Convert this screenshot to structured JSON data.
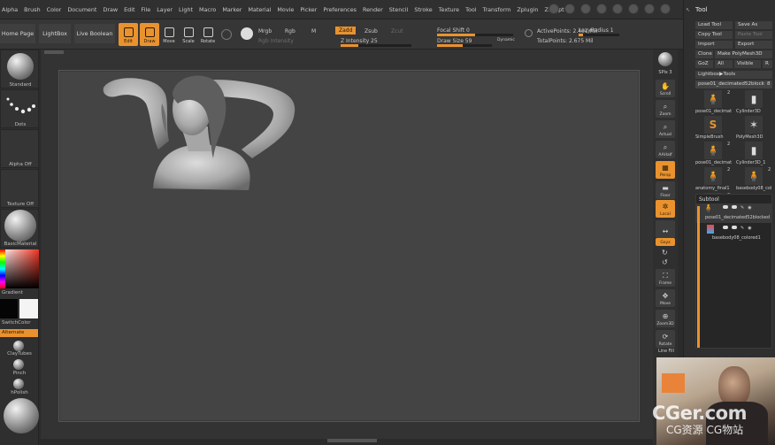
{
  "menu": [
    "Alpha",
    "Brush",
    "Color",
    "Document",
    "Draw",
    "Edit",
    "File",
    "Layer",
    "Light",
    "Macro",
    "Marker",
    "Material",
    "Movie",
    "Picker",
    "Preferences",
    "Render",
    "Stencil",
    "Stroke",
    "Texture",
    "Tool",
    "Transform",
    "Zplugin",
    "Zscript"
  ],
  "shelf": {
    "home_page": "Home Page",
    "lightbox": "LightBox",
    "live_boolean": "Live Boolean",
    "edit": "Edit",
    "draw": "Draw",
    "move": "Move",
    "scale": "Scale",
    "rotate": "Rotate",
    "mrgb": "Mrgb",
    "rgb": "Rgb",
    "m": "M",
    "rgb_intensity": "Rgb Intensity",
    "zadd": "Zadd",
    "zsub": "Zsub",
    "zcut": "Zcut",
    "z_intensity": "Z Intensity 25",
    "focal_shift": "Focal Shift 0",
    "draw_size": "Draw Size 59",
    "dynamic": "Dynamic",
    "active_points": "ActivePoints: 2.401 Mil",
    "total_points": "TotalPoints: 2.675 Mil",
    "lazy_radius": "LazyRadius 1"
  },
  "progress": {
    "z_intensity": 0.25,
    "draw_size": 0.47,
    "lazy_radius": 0.1
  },
  "left": {
    "standard": "Standard",
    "dots": "Dots",
    "alpha_off": "Alpha Off",
    "texture_off": "Texture Off",
    "basic_material": "BasicMaterial",
    "gradient": "Gradient",
    "switch_color": "SwitchColor",
    "alternate": "Alternate",
    "clay_tubes": "ClayTubes",
    "pinch": "Pinch",
    "hpolish": "hPolish"
  },
  "right_tools": {
    "spix": "SPix 3",
    "scroll": "Scroll",
    "zoom": "Zoom",
    "actual": "Actual",
    "aahalf": "AAHalf",
    "persp": "Persp",
    "floor": "Floor",
    "local": "Local",
    "xyz": "Gxyz",
    "frame": "Frame",
    "move": "Move",
    "zoom3d": "Zoom3D",
    "rotate": "Rotate",
    "line_fill": "Line Fill"
  },
  "toolpanel": {
    "title": "Tool",
    "load_tool": "Load Tool",
    "save_as": "Save As",
    "copy_tool": "Copy Tool",
    "paste_tool": "Paste Tool",
    "import": "Import",
    "export": "Export",
    "clone": "Clone",
    "make_polymesh": "Make PolyMesh3D",
    "goz": "GoZ",
    "all": "All",
    "visible": "Visible",
    "r": "R",
    "lightbox_tools": "Lightbox▶Tools",
    "current_tool": "pose01_decimated52blocked",
    "current_count": "8",
    "tools": [
      {
        "label": "pose01_decimat",
        "count": "2",
        "icon": "figure-icon"
      },
      {
        "label": "Cylinder3D",
        "count": "",
        "icon": "cylinder-icon"
      },
      {
        "label": "SimpleBrush",
        "count": "",
        "icon": "simplebrush-icon"
      },
      {
        "label": "PolyMesh3D",
        "count": "",
        "icon": "star-icon"
      },
      {
        "label": "pose01_decimat",
        "count": "2",
        "icon": "figure-icon"
      },
      {
        "label": "Cylinder3D_1",
        "count": "",
        "icon": "cylinder-icon"
      },
      {
        "label": "anatomy_final1",
        "count": "2",
        "icon": "figure-icon"
      },
      {
        "label": "basebody08_col",
        "count": "2",
        "icon": "figure-icon"
      },
      {
        "label": "female_pose02_f",
        "count": "2",
        "icon": "figure-icon"
      }
    ],
    "subtool": "Subtool",
    "subtools": [
      "pose01_decimated52blocked",
      "basebody08_colored1"
    ]
  },
  "watermark": {
    "main": "CGer.com",
    "sub": "CG资源 CG物站"
  },
  "colors": {
    "accent": "#e9922e",
    "panel": "#2f2f2f",
    "canvas": "#444444"
  }
}
